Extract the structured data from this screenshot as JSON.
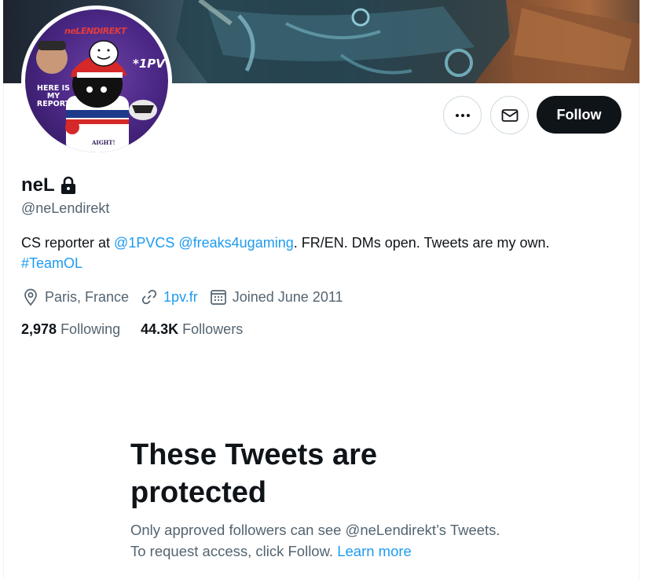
{
  "profile": {
    "name": "neL",
    "handle": "@neLendirekt",
    "bio_prefix": "CS reporter at ",
    "bio_mention_1": "@1PVCS",
    "bio_space": " ",
    "bio_mention_2": "@freaks4ugaming",
    "bio_suffix": ". FR/EN. DMs open. Tweets are my own.",
    "bio_hashtag": "#TeamOL",
    "location": "Paris, France",
    "website": "1pv.fr",
    "joined": "Joined June 2011",
    "following_count": "2,978",
    "following_label": "Following",
    "followers_count": "44.3K",
    "followers_label": "Followers"
  },
  "avatar": {
    "brand": "neL",
    "brand_suffix": "ENDIREKT",
    "tag": "*1PV",
    "report_text": "HERE IS MY REPORT",
    "shirt_text": "AIGHT!"
  },
  "actions": {
    "more_icon": "more-horizontal-icon",
    "message_icon": "envelope-icon",
    "follow_label": "Follow"
  },
  "protected": {
    "title": "These Tweets are protected",
    "description": "Only approved followers can see @neLendirekt’s Tweets. To request access, click Follow. ",
    "learn_more": "Learn more"
  },
  "colors": {
    "accent": "#1d9bf0",
    "text_primary": "#0f1419",
    "text_secondary": "#536471",
    "follow_bg": "#0f1419"
  }
}
